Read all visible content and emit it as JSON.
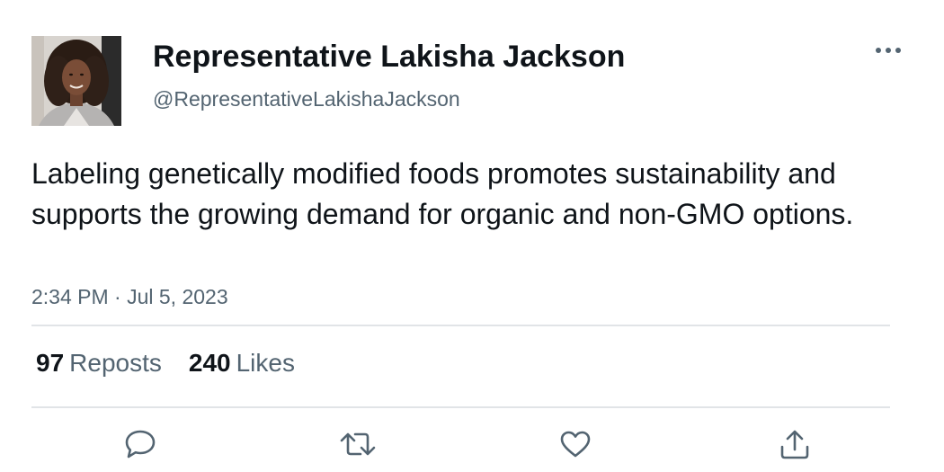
{
  "author": {
    "display_name": "Representative Lakisha Jackson",
    "handle": "@RepresentativeLakishaJackson"
  },
  "tweet": {
    "text": "Labeling genetically modified foods promotes sustainability and supports the growing demand for organic and non-GMO options.",
    "timestamp": "2:34 PM · Jul 5, 2023"
  },
  "stats": {
    "reposts_count": "97",
    "reposts_label": "Reposts",
    "likes_count": "240",
    "likes_label": "Likes"
  },
  "icons": {
    "more": "more-horizontal-icon",
    "reply": "reply-icon",
    "repost": "repost-icon",
    "like": "heart-icon",
    "share": "share-icon"
  },
  "colors": {
    "text": "#0f1419",
    "secondary": "#536471",
    "divider": "#e1e4e7",
    "icon": "#536471"
  }
}
